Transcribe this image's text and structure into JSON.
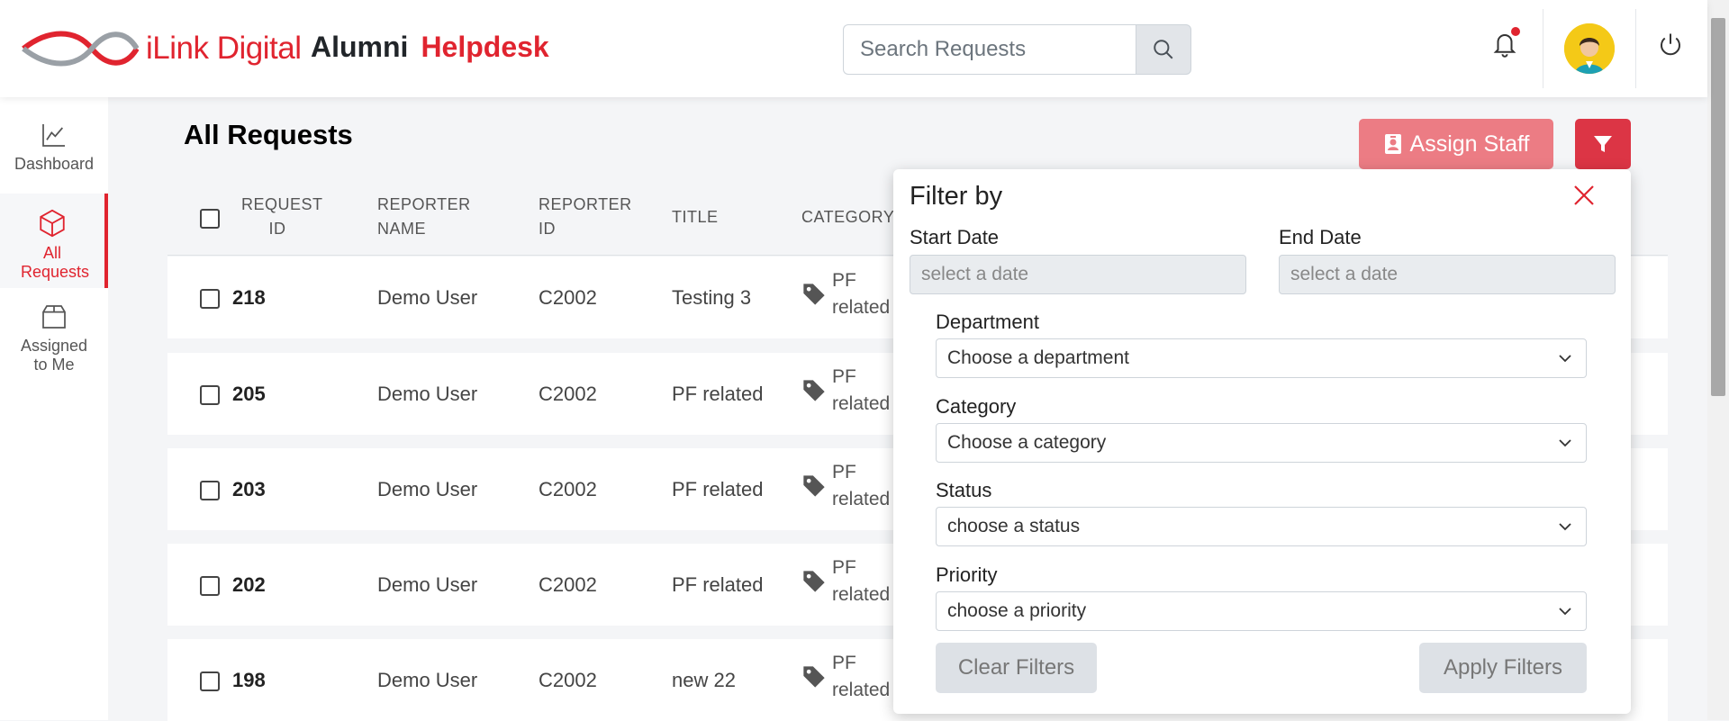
{
  "header": {
    "logo_text": "iLink Digital",
    "title_part1": "Alumni",
    "title_part2": "Helpdesk",
    "search_placeholder": "Search Requests"
  },
  "sidebar": {
    "items": [
      {
        "label": "Dashboard",
        "icon": "chart-line-icon"
      },
      {
        "label": "All Requests",
        "icon": "box-icon",
        "active": true
      },
      {
        "label": "Assigned to Me",
        "icon": "inbox-box-icon"
      }
    ]
  },
  "main": {
    "title": "All Requests",
    "assign_button": "Assign Staff"
  },
  "table": {
    "headers": {
      "request_id": "REQUEST ID",
      "reporter_name": "REPORTER NAME",
      "reporter_id": "REPORTER ID",
      "title": "TITLE",
      "category": "CATEGORY"
    },
    "rows": [
      {
        "id": "218",
        "name": "Demo User",
        "reporter_id": "C2002",
        "title": "Testing 3",
        "category_l1": "PF",
        "category_l2": "related"
      },
      {
        "id": "205",
        "name": "Demo User",
        "reporter_id": "C2002",
        "title": "PF related",
        "category_l1": "PF",
        "category_l2": "related"
      },
      {
        "id": "203",
        "name": "Demo User",
        "reporter_id": "C2002",
        "title": "PF related",
        "category_l1": "PF",
        "category_l2": "related"
      },
      {
        "id": "202",
        "name": "Demo User",
        "reporter_id": "C2002",
        "title": "PF related",
        "category_l1": "PF",
        "category_l2": "related"
      },
      {
        "id": "198",
        "name": "Demo User",
        "reporter_id": "C2002",
        "title": "new 22",
        "category_l1": "PF",
        "category_l2": "related"
      }
    ]
  },
  "filter": {
    "title": "Filter by",
    "start_date_label": "Start Date",
    "start_date_placeholder": "select a date",
    "end_date_label": "End Date",
    "end_date_placeholder": "select a date",
    "department_label": "Department",
    "department_value": "Choose a department",
    "category_label": "Category",
    "category_value": "Choose a category",
    "status_label": "Status",
    "status_value": "choose a status",
    "priority_label": "Priority",
    "priority_value": "choose a priority",
    "clear_button": "Clear Filters",
    "apply_button": "Apply Filters"
  },
  "colors": {
    "brand_red": "#e0242f",
    "assign_button_bg": "#ec7c84",
    "filter_button_bg": "#dc3545"
  }
}
